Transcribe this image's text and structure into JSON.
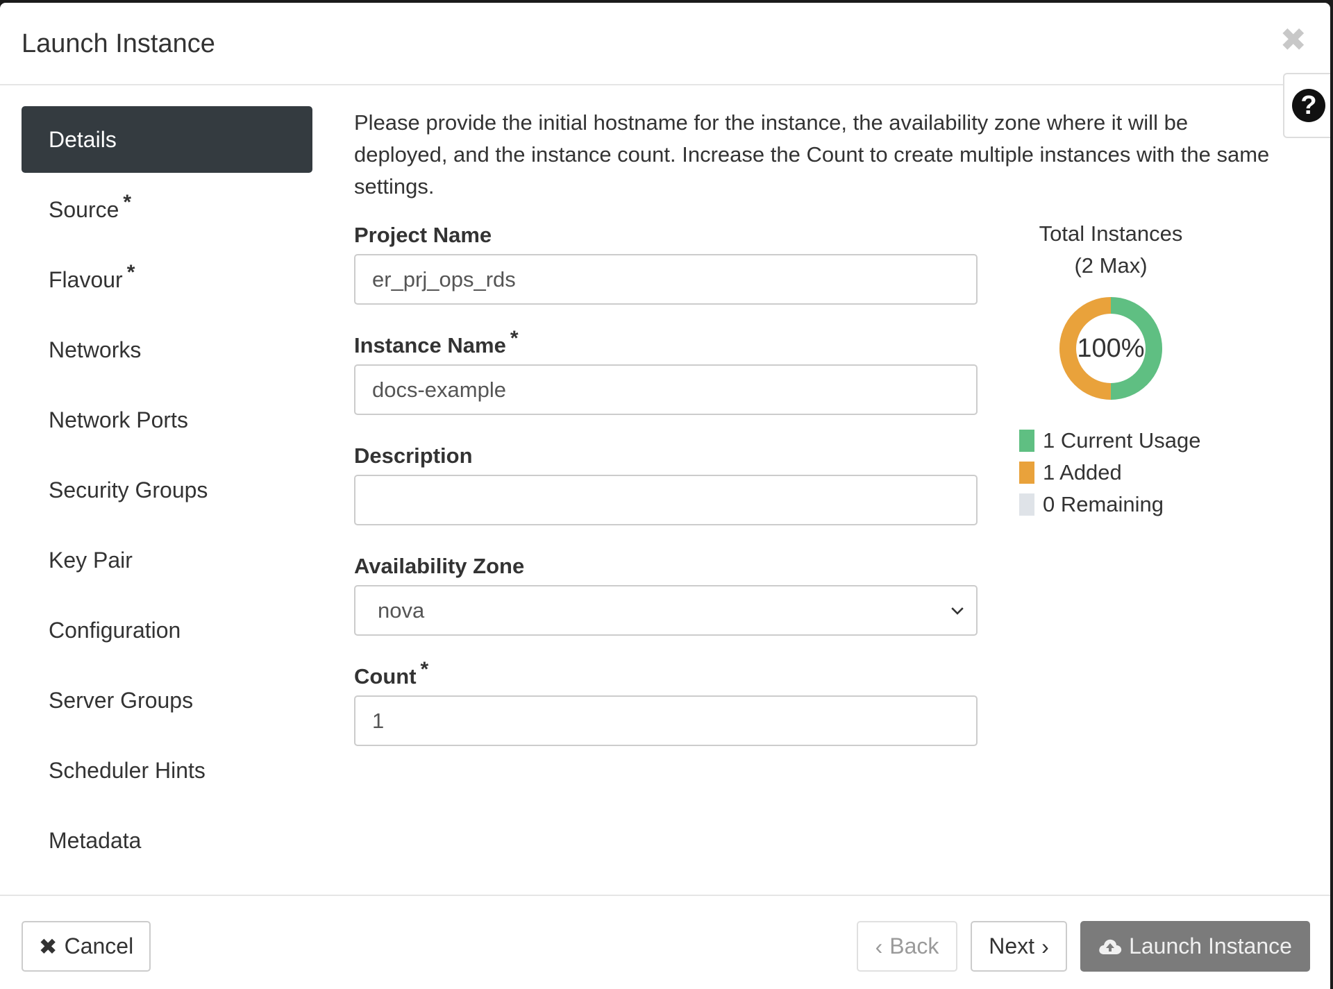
{
  "modal": {
    "title": "Launch Instance",
    "close_icon": "close-icon",
    "help_icon": "help-icon",
    "help_glyph": "?"
  },
  "sidebar": {
    "items": [
      {
        "label": "Details",
        "required": false,
        "active": true
      },
      {
        "label": "Source",
        "required": true,
        "active": false
      },
      {
        "label": "Flavour",
        "required": true,
        "active": false
      },
      {
        "label": "Networks",
        "required": false,
        "active": false
      },
      {
        "label": "Network Ports",
        "required": false,
        "active": false
      },
      {
        "label": "Security Groups",
        "required": false,
        "active": false
      },
      {
        "label": "Key Pair",
        "required": false,
        "active": false
      },
      {
        "label": "Configuration",
        "required": false,
        "active": false
      },
      {
        "label": "Server Groups",
        "required": false,
        "active": false
      },
      {
        "label": "Scheduler Hints",
        "required": false,
        "active": false
      },
      {
        "label": "Metadata",
        "required": false,
        "active": false
      }
    ],
    "required_marker": "*"
  },
  "main": {
    "intro": "Please provide the initial hostname for the instance, the availability zone where it will be deployed, and the instance count. Increase the Count to create multiple instances with the same settings.",
    "project_name": {
      "label": "Project Name",
      "value": "er_prj_ops_rds"
    },
    "instance_name": {
      "label": "Instance Name",
      "value": "docs-example",
      "required": true
    },
    "description": {
      "label": "Description",
      "value": ""
    },
    "availability_zone": {
      "label": "Availability Zone",
      "value": "nova"
    },
    "count": {
      "label": "Count",
      "value": "1",
      "required": true
    }
  },
  "chart_data": {
    "type": "pie",
    "title_line1": "Total Instances",
    "title_line2": "(2 Max)",
    "center_label": "100%",
    "max": 2,
    "slices": [
      {
        "label": "1 Current Usage",
        "value": 1,
        "color": "#5fbf82"
      },
      {
        "label": "1 Added",
        "value": 1,
        "color": "#e9a23b"
      },
      {
        "label": "0 Remaining",
        "value": 0,
        "color": "#dfe3e8"
      }
    ]
  },
  "footer": {
    "cancel_label": "Cancel",
    "back_label": "Back",
    "next_label": "Next",
    "launch_label": "Launch Instance"
  },
  "colors": {
    "active_nav": "#343b40",
    "launch_button": "#7b7b7b"
  }
}
